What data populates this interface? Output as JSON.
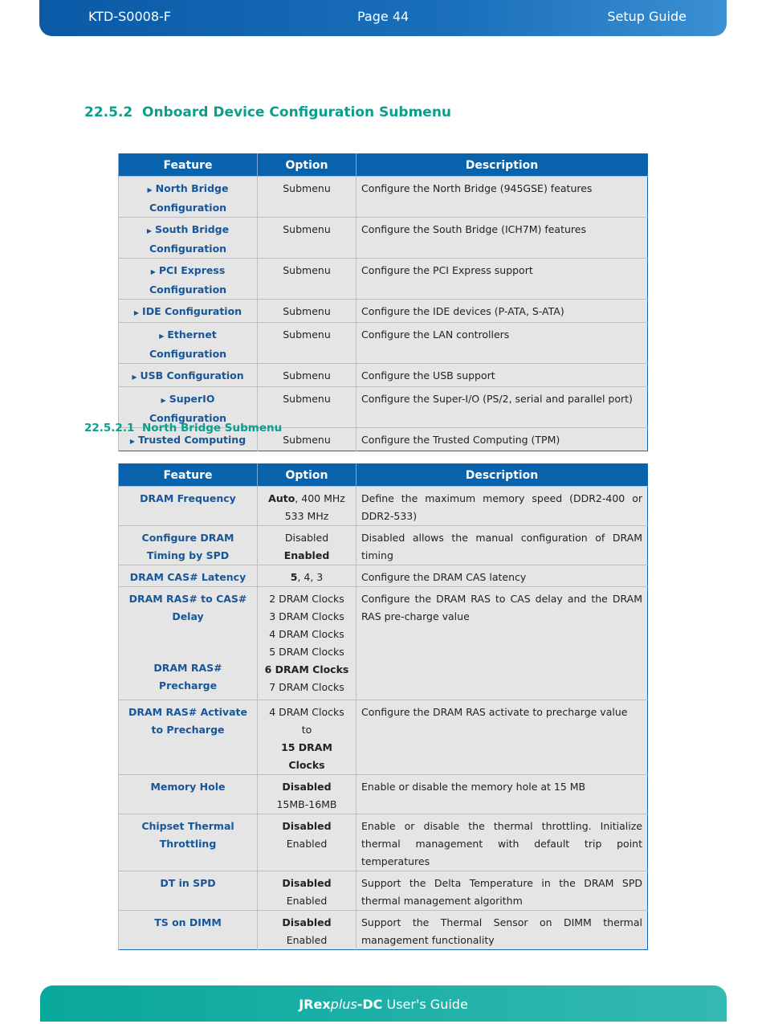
{
  "header": {
    "doc_id": "KTD-S0008-F",
    "page": "Page 44",
    "guide": "Setup Guide"
  },
  "section": {
    "number": "22.5.2",
    "title": "Onboard Device Configuration Submenu"
  },
  "subsection": {
    "number": "22.5.2.1",
    "title": "North Bridge Submenu"
  },
  "columns": [
    "Feature",
    "Option",
    "Description"
  ],
  "table1": [
    {
      "feature": [
        "North Bridge",
        "Configuration"
      ],
      "option": "Submenu",
      "desc": "Configure the North Bridge (945GSE) features",
      "h": 46
    },
    {
      "feature": [
        "South Bridge",
        "Configuration"
      ],
      "option": "Submenu",
      "desc": "Configure the South Bridge (ICH7M) features",
      "h": 46
    },
    {
      "feature": [
        "PCI Express",
        "Configuration"
      ],
      "option": "Submenu",
      "desc": "Configure the PCI Express support",
      "h": 46
    },
    {
      "feature": [
        "IDE Configuration"
      ],
      "option": "Submenu",
      "desc": "Configure the IDE devices (P-ATA, S-ATA)",
      "h": 25
    },
    {
      "feature": [
        "Ethernet Configuration"
      ],
      "option": "Submenu",
      "desc": "Configure the LAN controllers",
      "h": 25
    },
    {
      "feature": [
        "USB Configuration"
      ],
      "option": "Submenu",
      "desc": "Configure the USB support",
      "h": 25
    },
    {
      "feature": [
        "SuperIO Configuration"
      ],
      "option": "Submenu",
      "desc": "Configure the Super-I/O (PS/2, serial and parallel port)",
      "h": 25
    },
    {
      "feature": [
        "Trusted Computing"
      ],
      "option": "Submenu",
      "desc": "Configure the Trusted Computing (TPM)",
      "h": 25
    }
  ],
  "table2": [
    {
      "feature": [
        "DRAM Frequency"
      ],
      "options": [
        [
          {
            "t": "Auto",
            "b": true
          },
          {
            "t": ", 400 MHz"
          }
        ],
        [
          {
            "t": "533 MHz"
          }
        ]
      ],
      "desc": "Define the maximum memory speed (DDR2-400 or DDR2-533)",
      "h": 49
    },
    {
      "feature": [
        "Configure DRAM Timing by SPD"
      ],
      "options": [
        [
          {
            "t": "Disabled"
          }
        ],
        [
          {
            "t": "Enabled",
            "b": true
          }
        ]
      ],
      "desc": "Disabled allows the manual configuration of DRAM timing",
      "h": 48
    },
    {
      "feature": [
        "DRAM CAS# Latency"
      ],
      "options": [
        [
          {
            "t": "5",
            "b": true
          },
          {
            "t": ", 4, 3"
          }
        ]
      ],
      "desc": "Configure the DRAM CAS latency",
      "h": 25
    },
    {
      "feature": [
        "DRAM RAS# to CAS# Delay",
        "DRAM RAS# Precharge"
      ],
      "options": [
        [
          {
            "t": "2 DRAM Clocks"
          }
        ],
        [
          {
            "t": "3 DRAM Clocks"
          }
        ],
        [
          {
            "t": "4 DRAM Clocks"
          }
        ],
        [
          {
            "t": "5 DRAM Clocks"
          }
        ],
        [
          {
            "t": "6 DRAM Clocks",
            "b": true
          }
        ],
        [
          {
            "t": "7 DRAM Clocks"
          }
        ]
      ],
      "desc": "Configure the DRAM RAS to CAS delay and the DRAM RAS pre-charge value",
      "h": 141
    },
    {
      "feature": [
        "DRAM RAS# Activate to Precharge"
      ],
      "options": [
        [
          {
            "t": "4 DRAM Clocks"
          }
        ],
        [
          {
            "t": "to"
          }
        ],
        [
          {
            "t": "15 DRAM Clocks",
            "b": true
          }
        ]
      ],
      "desc": "Configure the DRAM RAS activate to precharge value",
      "h": 71
    },
    {
      "feature": [
        "Memory Hole"
      ],
      "options": [
        [
          {
            "t": "Disabled",
            "b": true
          }
        ],
        [
          {
            "t": "15MB-16MB"
          }
        ]
      ],
      "desc": "Enable or disable the memory hole at 15 MB",
      "h": 49
    },
    {
      "feature": [
        "Chipset Thermal Throttling"
      ],
      "options": [
        [
          {
            "t": "Disabled",
            "b": true
          }
        ],
        [
          {
            "t": "Enabled"
          }
        ]
      ],
      "desc": "Enable or disable the thermal throttling. Initialize thermal management with default trip point temperatures",
      "h": 48
    },
    {
      "feature": [
        "DT in SPD"
      ],
      "options": [
        [
          {
            "t": "Disabled",
            "b": true
          }
        ],
        [
          {
            "t": "Enabled"
          }
        ]
      ],
      "desc": "Support the Delta Temperature in the DRAM SPD thermal management algorithm",
      "h": 48
    },
    {
      "feature": [
        "TS on DIMM"
      ],
      "options": [
        [
          {
            "t": "Disabled",
            "b": true
          }
        ],
        [
          {
            "t": "Enabled"
          }
        ]
      ],
      "desc": "Support the Thermal Sensor on DIMM thermal management functionality",
      "h": 49
    }
  ],
  "footer": {
    "brand_a": "JRex",
    "brand_b": "plus",
    "brand_c": "-DC",
    "rest": " User's Guide"
  },
  "colors": {
    "header_blue": "#0862ac",
    "feature_text": "#17569a",
    "heading_teal": "#0b9e8c",
    "footer_teal": "#08a79c"
  }
}
